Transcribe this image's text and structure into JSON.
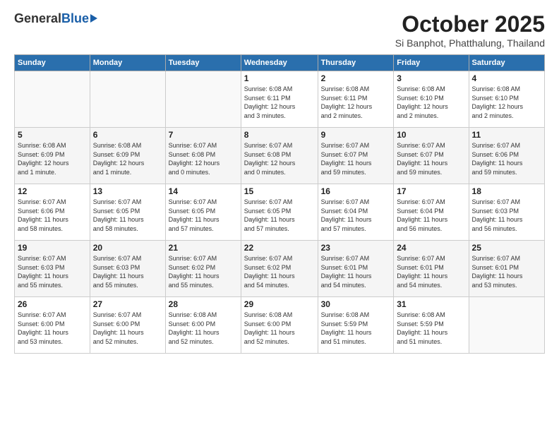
{
  "header": {
    "logo_general": "General",
    "logo_blue": "Blue",
    "main_title": "October 2025",
    "subtitle": "Si Banphot, Phatthalung, Thailand"
  },
  "weekdays": [
    "Sunday",
    "Monday",
    "Tuesday",
    "Wednesday",
    "Thursday",
    "Friday",
    "Saturday"
  ],
  "weeks": [
    [
      {
        "day": "",
        "info": ""
      },
      {
        "day": "",
        "info": ""
      },
      {
        "day": "",
        "info": ""
      },
      {
        "day": "1",
        "info": "Sunrise: 6:08 AM\nSunset: 6:11 PM\nDaylight: 12 hours\nand 3 minutes."
      },
      {
        "day": "2",
        "info": "Sunrise: 6:08 AM\nSunset: 6:11 PM\nDaylight: 12 hours\nand 2 minutes."
      },
      {
        "day": "3",
        "info": "Sunrise: 6:08 AM\nSunset: 6:10 PM\nDaylight: 12 hours\nand 2 minutes."
      },
      {
        "day": "4",
        "info": "Sunrise: 6:08 AM\nSunset: 6:10 PM\nDaylight: 12 hours\nand 2 minutes."
      }
    ],
    [
      {
        "day": "5",
        "info": "Sunrise: 6:08 AM\nSunset: 6:09 PM\nDaylight: 12 hours\nand 1 minute."
      },
      {
        "day": "6",
        "info": "Sunrise: 6:08 AM\nSunset: 6:09 PM\nDaylight: 12 hours\nand 1 minute."
      },
      {
        "day": "7",
        "info": "Sunrise: 6:07 AM\nSunset: 6:08 PM\nDaylight: 12 hours\nand 0 minutes."
      },
      {
        "day": "8",
        "info": "Sunrise: 6:07 AM\nSunset: 6:08 PM\nDaylight: 12 hours\nand 0 minutes."
      },
      {
        "day": "9",
        "info": "Sunrise: 6:07 AM\nSunset: 6:07 PM\nDaylight: 11 hours\nand 59 minutes."
      },
      {
        "day": "10",
        "info": "Sunrise: 6:07 AM\nSunset: 6:07 PM\nDaylight: 11 hours\nand 59 minutes."
      },
      {
        "day": "11",
        "info": "Sunrise: 6:07 AM\nSunset: 6:06 PM\nDaylight: 11 hours\nand 59 minutes."
      }
    ],
    [
      {
        "day": "12",
        "info": "Sunrise: 6:07 AM\nSunset: 6:06 PM\nDaylight: 11 hours\nand 58 minutes."
      },
      {
        "day": "13",
        "info": "Sunrise: 6:07 AM\nSunset: 6:05 PM\nDaylight: 11 hours\nand 58 minutes."
      },
      {
        "day": "14",
        "info": "Sunrise: 6:07 AM\nSunset: 6:05 PM\nDaylight: 11 hours\nand 57 minutes."
      },
      {
        "day": "15",
        "info": "Sunrise: 6:07 AM\nSunset: 6:05 PM\nDaylight: 11 hours\nand 57 minutes."
      },
      {
        "day": "16",
        "info": "Sunrise: 6:07 AM\nSunset: 6:04 PM\nDaylight: 11 hours\nand 57 minutes."
      },
      {
        "day": "17",
        "info": "Sunrise: 6:07 AM\nSunset: 6:04 PM\nDaylight: 11 hours\nand 56 minutes."
      },
      {
        "day": "18",
        "info": "Sunrise: 6:07 AM\nSunset: 6:03 PM\nDaylight: 11 hours\nand 56 minutes."
      }
    ],
    [
      {
        "day": "19",
        "info": "Sunrise: 6:07 AM\nSunset: 6:03 PM\nDaylight: 11 hours\nand 55 minutes."
      },
      {
        "day": "20",
        "info": "Sunrise: 6:07 AM\nSunset: 6:03 PM\nDaylight: 11 hours\nand 55 minutes."
      },
      {
        "day": "21",
        "info": "Sunrise: 6:07 AM\nSunset: 6:02 PM\nDaylight: 11 hours\nand 55 minutes."
      },
      {
        "day": "22",
        "info": "Sunrise: 6:07 AM\nSunset: 6:02 PM\nDaylight: 11 hours\nand 54 minutes."
      },
      {
        "day": "23",
        "info": "Sunrise: 6:07 AM\nSunset: 6:01 PM\nDaylight: 11 hours\nand 54 minutes."
      },
      {
        "day": "24",
        "info": "Sunrise: 6:07 AM\nSunset: 6:01 PM\nDaylight: 11 hours\nand 54 minutes."
      },
      {
        "day": "25",
        "info": "Sunrise: 6:07 AM\nSunset: 6:01 PM\nDaylight: 11 hours\nand 53 minutes."
      }
    ],
    [
      {
        "day": "26",
        "info": "Sunrise: 6:07 AM\nSunset: 6:00 PM\nDaylight: 11 hours\nand 53 minutes."
      },
      {
        "day": "27",
        "info": "Sunrise: 6:07 AM\nSunset: 6:00 PM\nDaylight: 11 hours\nand 52 minutes."
      },
      {
        "day": "28",
        "info": "Sunrise: 6:08 AM\nSunset: 6:00 PM\nDaylight: 11 hours\nand 52 minutes."
      },
      {
        "day": "29",
        "info": "Sunrise: 6:08 AM\nSunset: 6:00 PM\nDaylight: 11 hours\nand 52 minutes."
      },
      {
        "day": "30",
        "info": "Sunrise: 6:08 AM\nSunset: 5:59 PM\nDaylight: 11 hours\nand 51 minutes."
      },
      {
        "day": "31",
        "info": "Sunrise: 6:08 AM\nSunset: 5:59 PM\nDaylight: 11 hours\nand 51 minutes."
      },
      {
        "day": "",
        "info": ""
      }
    ]
  ]
}
